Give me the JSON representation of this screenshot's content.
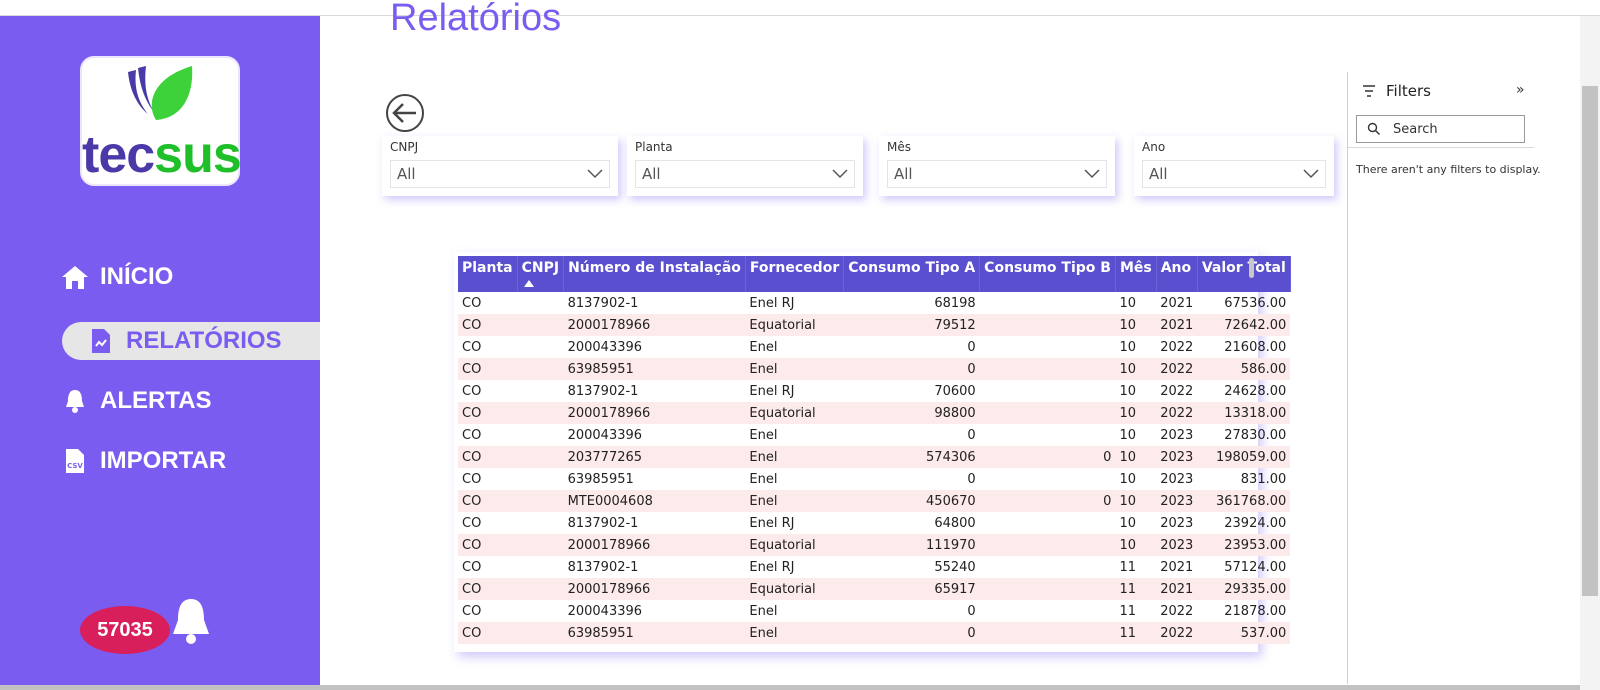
{
  "brand": {
    "logo_prefix": "tec",
    "logo_suffix": "sus"
  },
  "nav": [
    {
      "label": "INÍCIO",
      "icon": "home-icon"
    },
    {
      "label": "RELATÓRIOS",
      "icon": "report-icon"
    },
    {
      "label": "ALERTAS",
      "icon": "bell-icon"
    },
    {
      "label": "IMPORTAR",
      "icon": "csv-file-icon"
    }
  ],
  "alerts": {
    "count": "57035"
  },
  "page": {
    "title": "Relatórios"
  },
  "slicers": [
    {
      "label": "CNPJ",
      "value": "All"
    },
    {
      "label": "Planta",
      "value": "All"
    },
    {
      "label": "Mês",
      "value": "All"
    },
    {
      "label": "Ano",
      "value": "All"
    }
  ],
  "table": {
    "headers": [
      "Planta",
      "CNPJ",
      "Número de Instalação",
      "Fornecedor",
      "Consumo Tipo A",
      "Consumo Tipo B",
      "Mês",
      "Ano",
      "Valor Total"
    ],
    "rows": [
      [
        "CO",
        "",
        "8137902-1",
        "Enel RJ",
        "68198",
        "",
        "10",
        "2021",
        "67536.00"
      ],
      [
        "CO",
        "",
        "2000178966",
        "Equatorial",
        "79512",
        "",
        "10",
        "2021",
        "72642.00"
      ],
      [
        "CO",
        "",
        "200043396",
        "Enel",
        "0",
        "",
        "10",
        "2022",
        "21608.00"
      ],
      [
        "CO",
        "",
        "63985951",
        "Enel",
        "0",
        "",
        "10",
        "2022",
        "586.00"
      ],
      [
        "CO",
        "",
        "8137902-1",
        "Enel RJ",
        "70600",
        "",
        "10",
        "2022",
        "24628.00"
      ],
      [
        "CO",
        "",
        "2000178966",
        "Equatorial",
        "98800",
        "",
        "10",
        "2022",
        "13318.00"
      ],
      [
        "CO",
        "",
        "200043396",
        "Enel",
        "0",
        "",
        "10",
        "2023",
        "27830.00"
      ],
      [
        "CO",
        "",
        "203777265",
        "Enel",
        "574306",
        "0",
        "10",
        "2023",
        "198059.00"
      ],
      [
        "CO",
        "",
        "63985951",
        "Enel",
        "0",
        "",
        "10",
        "2023",
        "831.00"
      ],
      [
        "CO",
        "",
        "MTE0004608",
        "Enel",
        "450670",
        "0",
        "10",
        "2023",
        "361768.00"
      ],
      [
        "CO",
        "",
        "8137902-1",
        "Enel RJ",
        "64800",
        "",
        "10",
        "2023",
        "23924.00"
      ],
      [
        "CO",
        "",
        "2000178966",
        "Equatorial",
        "111970",
        "",
        "10",
        "2023",
        "23953.00"
      ],
      [
        "CO",
        "",
        "8137902-1",
        "Enel RJ",
        "55240",
        "",
        "11",
        "2021",
        "57124.00"
      ],
      [
        "CO",
        "",
        "2000178966",
        "Equatorial",
        "65917",
        "",
        "11",
        "2021",
        "29335.00"
      ],
      [
        "CO",
        "",
        "200043396",
        "Enel",
        "0",
        "",
        "11",
        "2022",
        "21878.00"
      ],
      [
        "CO",
        "",
        "63985951",
        "Enel",
        "0",
        "",
        "11",
        "2022",
        "537.00"
      ]
    ]
  },
  "filters": {
    "title": "Filters",
    "search_placeholder": "Search",
    "empty_message": "There aren't any filters to display."
  },
  "colors": {
    "sidebar": "#7b5cf0",
    "table_header": "#5a4fcf",
    "alert_badge": "#d81e5b",
    "row_stripe": "#fdeaea"
  }
}
